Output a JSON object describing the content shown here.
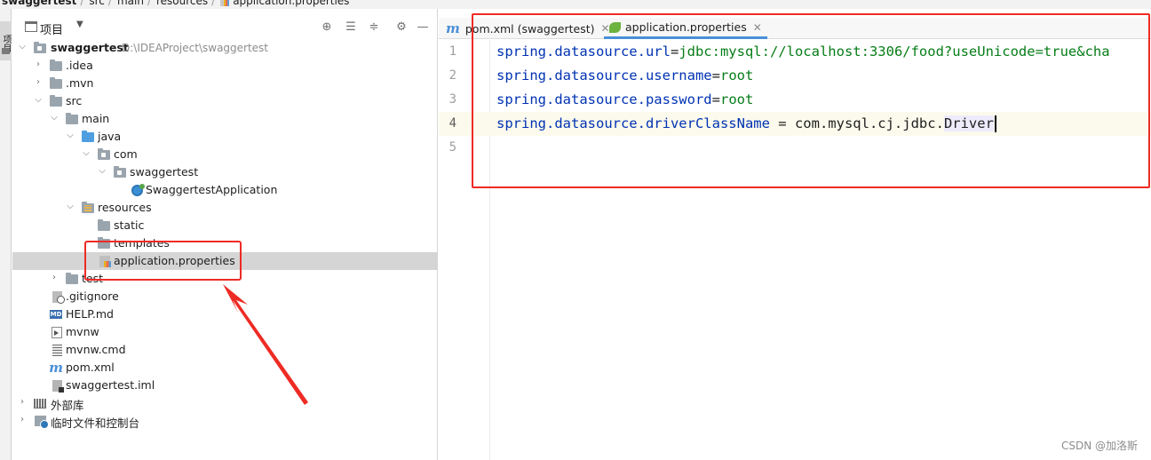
{
  "breadcrumb": {
    "project": "swaggertest",
    "seg1": "src",
    "seg2": "main",
    "seg3": "resources",
    "file": "application.properties"
  },
  "left_stripe": {
    "label": "项目"
  },
  "project_panel": {
    "title": "项目",
    "toolbar": [
      "locate-icon",
      "expand-all-icon",
      "collapse-all-icon",
      "gear-icon",
      "hide-icon"
    ],
    "tree": [
      {
        "label": "swaggertest",
        "path": "D:\\IDEAProject\\swaggertest"
      },
      {
        "label": ".idea"
      },
      {
        "label": ".mvn"
      },
      {
        "label": "src"
      },
      {
        "label": "main"
      },
      {
        "label": "java"
      },
      {
        "label": "com"
      },
      {
        "label": "swaggertest"
      },
      {
        "label": "SwaggertestApplication"
      },
      {
        "label": "resources"
      },
      {
        "label": "static"
      },
      {
        "label": "templates"
      },
      {
        "label": "application.properties"
      },
      {
        "label": "test"
      },
      {
        "label": ".gitignore"
      },
      {
        "label": "HELP.md"
      },
      {
        "label": "mvnw"
      },
      {
        "label": "mvnw.cmd"
      },
      {
        "label": "pom.xml"
      },
      {
        "label": "swaggertest.iml"
      },
      {
        "label": "外部库"
      },
      {
        "label": "临时文件和控制台"
      }
    ]
  },
  "editor": {
    "tabs": [
      {
        "label": "pom.xml (swaggertest)",
        "icon": "maven-m-icon",
        "active": false
      },
      {
        "label": "application.properties",
        "icon": "spring-leaf-icon",
        "active": true
      }
    ],
    "line_numbers": [
      "1",
      "2",
      "3",
      "4",
      "5"
    ],
    "current_line": 4,
    "lines": [
      {
        "key": "spring.datasource.url",
        "sep": "=",
        "value": "jdbc:mysql://localhost:3306/food?useUnicode=true&cha"
      },
      {
        "key": "spring.datasource.username",
        "sep": "=",
        "value": "root"
      },
      {
        "key": "spring.datasource.password",
        "sep": "=",
        "value": "root"
      },
      {
        "key": "spring.datasource.driverClassName",
        "sep": " = ",
        "value_plain": "com.mysql.cj.jdbc.",
        "value_highlight": "Driver"
      },
      {
        "key": "",
        "sep": "",
        "value": ""
      }
    ]
  },
  "annotation_color": "#ee2b24",
  "watermark": "CSDN @加洛斯"
}
